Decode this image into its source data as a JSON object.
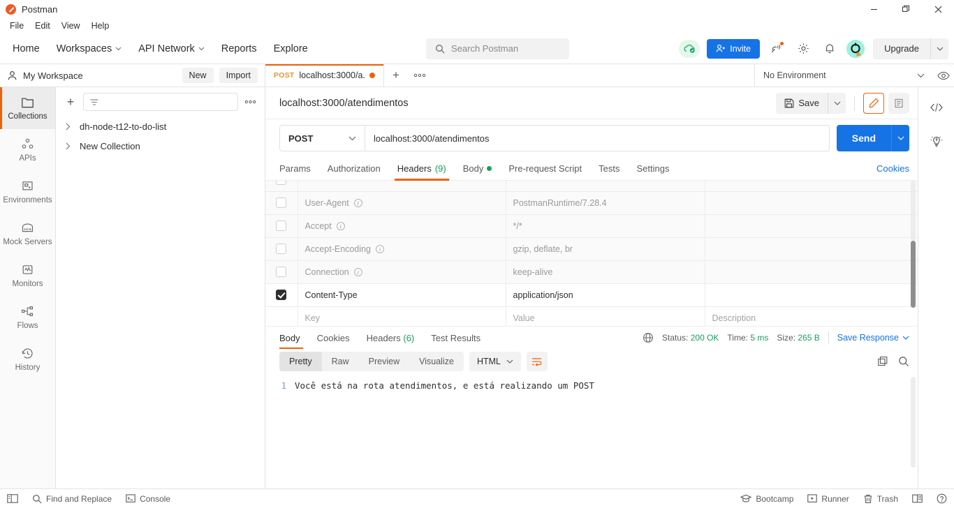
{
  "window": {
    "title": "Postman",
    "logo_icon": "postman-logo-icon",
    "minimize": "—",
    "maximize": "❐",
    "close": "✕"
  },
  "menubar": {
    "items": [
      "File",
      "Edit",
      "View",
      "Help"
    ]
  },
  "navbar": {
    "links": [
      {
        "label": "Home",
        "has_caret": false
      },
      {
        "label": "Workspaces",
        "has_caret": true
      },
      {
        "label": "API Network",
        "has_caret": true
      },
      {
        "label": "Reports",
        "has_caret": false
      },
      {
        "label": "Explore",
        "has_caret": false
      }
    ],
    "search_placeholder": "Search Postman",
    "search_icon": "search-icon",
    "cloud_icon": "cloud-sync-ok-icon",
    "invite_label": "Invite",
    "invite_icon": "user-add-icon",
    "broadcast_icon": "satellite-broadcast-icon",
    "settings_icon": "gear-icon",
    "notifications_icon": "bell-icon",
    "avatar_icon": "user-avatar-icon",
    "upgrade_label": "Upgrade",
    "caret_glyph": "⌄"
  },
  "workspace_bar": {
    "name": "My Workspace",
    "person_icon": "person-icon",
    "new_label": "New",
    "import_label": "Import",
    "tabs": [
      {
        "method": "POST",
        "name": "localhost:3000/a...",
        "dirty": true,
        "active": true
      }
    ],
    "new_tab_glyph": "+",
    "more_tabs_glyph": "●●●",
    "environment": "No Environment",
    "env_eye_icon": "eye-icon"
  },
  "sidebar_rail": {
    "items": [
      {
        "label": "Collections",
        "icon": "collections-icon",
        "active": true
      },
      {
        "label": "APIs",
        "icon": "apis-icon",
        "active": false
      },
      {
        "label": "Environments",
        "icon": "environments-icon",
        "active": false
      },
      {
        "label": "Mock Servers",
        "icon": "mock-servers-icon",
        "active": false
      },
      {
        "label": "Monitors",
        "icon": "monitors-icon",
        "active": false
      },
      {
        "label": "Flows",
        "icon": "flows-icon",
        "active": false
      },
      {
        "label": "History",
        "icon": "history-icon",
        "active": false
      }
    ]
  },
  "collections_panel": {
    "add_glyph": "+",
    "filter_icon": "filter-icon",
    "filter_value": "",
    "more_glyph": "●●●",
    "items": [
      {
        "label": "dh-node-t12-to-do-list",
        "chevron": "›"
      },
      {
        "label": "New Collection",
        "chevron": "›"
      }
    ]
  },
  "request": {
    "title": "localhost:3000/atendimentos",
    "save_label": "Save",
    "save_icon": "floppy-disk-icon",
    "save_caret": "⌄",
    "edit_icon": "pencil-icon",
    "comment_icon": "comment-icon",
    "method": "POST",
    "method_caret": "⌄",
    "url": "localhost:3000/atendimentos",
    "send_label": "Send",
    "send_caret": "⌄",
    "tabs": [
      {
        "label": "Params",
        "active": false,
        "count": "",
        "dot": false
      },
      {
        "label": "Authorization",
        "active": false,
        "count": "",
        "dot": false
      },
      {
        "label": "Headers",
        "active": true,
        "count": "(9)",
        "dot": false
      },
      {
        "label": "Body",
        "active": false,
        "count": "",
        "dot": true
      },
      {
        "label": "Pre-request Script",
        "active": false,
        "count": "",
        "dot": false
      },
      {
        "label": "Tests",
        "active": false,
        "count": "",
        "dot": false
      },
      {
        "label": "Settings",
        "active": false,
        "count": "",
        "dot": false
      }
    ],
    "cookies_label": "Cookies"
  },
  "headers_table": {
    "columns": [
      "",
      "Key",
      "Value",
      "Description"
    ],
    "rows": [
      {
        "checked": false,
        "key": "",
        "value": "",
        "description": "",
        "preset": true,
        "info": false,
        "partial": true
      },
      {
        "checked": false,
        "key": "User-Agent",
        "value": "PostmanRuntime/7.28.4",
        "description": "",
        "preset": true,
        "info": true
      },
      {
        "checked": false,
        "key": "Accept",
        "value": "*/*",
        "description": "",
        "preset": true,
        "info": true
      },
      {
        "checked": false,
        "key": "Accept-Encoding",
        "value": "gzip, deflate, br",
        "description": "",
        "preset": true,
        "info": true
      },
      {
        "checked": false,
        "key": "Connection",
        "value": "keep-alive",
        "description": "",
        "preset": true,
        "info": true
      },
      {
        "checked": true,
        "key": "Content-Type",
        "value": "application/json",
        "description": "",
        "preset": false,
        "info": false
      },
      {
        "checked": null,
        "key": "Key",
        "value": "Value",
        "description": "Description",
        "preset": false,
        "blank": true,
        "info": false
      }
    ]
  },
  "response": {
    "tabs": [
      {
        "label": "Body",
        "active": true,
        "count": ""
      },
      {
        "label": "Cookies",
        "active": false,
        "count": ""
      },
      {
        "label": "Headers",
        "active": false,
        "count": "(6)"
      },
      {
        "label": "Test Results",
        "active": false,
        "count": ""
      }
    ],
    "globe_icon": "globe-icon",
    "status_label": "Status:",
    "status_value": "200 OK",
    "time_label": "Time:",
    "time_value": "5 ms",
    "size_label": "Size:",
    "size_value": "265 B",
    "save_response_label": "Save Response",
    "save_response_caret": "⌄",
    "format_tabs": [
      {
        "label": "Pretty",
        "active": true
      },
      {
        "label": "Raw",
        "active": false
      },
      {
        "label": "Preview",
        "active": false
      },
      {
        "label": "Visualize",
        "active": false
      }
    ],
    "language": "HTML",
    "language_caret": "⌄",
    "wrap_icon": "word-wrap-icon",
    "copy_icon": "copy-icon",
    "search_icon": "search-icon",
    "body_lines": [
      {
        "number": "1",
        "text": "Você está na rota atendimentos, e está realizando um POST"
      }
    ]
  },
  "right_rail": {
    "items": [
      {
        "icon": "code-snippet-icon",
        "label": "</>"
      },
      {
        "icon": "lightbulb-icon",
        "label": ""
      }
    ]
  },
  "statusbar": {
    "left": [
      {
        "label": "",
        "icon": "sidebar-toggle-icon"
      },
      {
        "label": "Find and Replace",
        "icon": "search-icon"
      },
      {
        "label": "Console",
        "icon": "console-icon"
      }
    ],
    "right": [
      {
        "label": "Bootcamp",
        "icon": "graduation-cap-icon"
      },
      {
        "label": "Runner",
        "icon": "runner-icon"
      },
      {
        "label": "Trash",
        "icon": "trash-icon"
      },
      {
        "label": "",
        "icon": "layout-panes-icon"
      },
      {
        "label": "",
        "icon": "help-icon"
      }
    ]
  },
  "colors": {
    "accent_orange": "#f0610a",
    "blue": "#1573e6",
    "green": "#17a05e",
    "method_post": "#f0932b"
  }
}
